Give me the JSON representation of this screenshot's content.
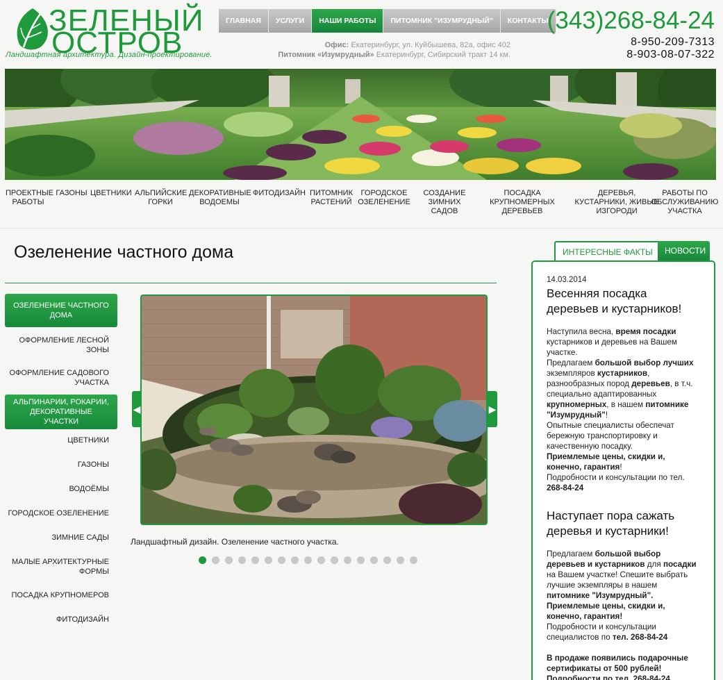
{
  "logo": {
    "word1": "ЗЕЛЕНЫЙ",
    "word2": "ОСТРОВ",
    "tagline": "Ландшафтная архитектура. Дизайн-проектирование."
  },
  "topnav": [
    {
      "label": "ГЛАВНАЯ"
    },
    {
      "label": "УСЛУГИ"
    },
    {
      "label": "НАШИ РАБОТЫ",
      "active": true
    },
    {
      "label": "ПИТОМНИК \"ИЗУМРУДНЫЙ\""
    },
    {
      "label": "КОНТАКТЫ"
    }
  ],
  "office": {
    "office_label": "Офис:",
    "office_address": "Екатеринбург, ул. Куйбышева, 82а, офис 402",
    "nursery_label": "Питомник «Изумрудный»",
    "nursery_address": "Екатеринбург, Сибирский тракт 14 км."
  },
  "phones": {
    "main": "(343)268-84-24",
    "alt1": "8-950-209-7313",
    "alt2": "8-903-08-07-322"
  },
  "catnav": [
    {
      "l1": "ПРОЕКТНЫЕ",
      "l2": "РАБОТЫ",
      "l3": ""
    },
    {
      "l1": "ГАЗОНЫ",
      "l2": "",
      "l3": ""
    },
    {
      "l1": "ЦВЕТНИКИ",
      "l2": "",
      "l3": ""
    },
    {
      "l1": "АЛЬПИЙСКИЕ",
      "l2": "ГОРКИ",
      "l3": ""
    },
    {
      "l1": "ДЕКОРАТИВНЫЕ",
      "l2": "ВОДОЕМЫ",
      "l3": ""
    },
    {
      "l1": "ФИТОДИЗАЙН",
      "l2": "",
      "l3": ""
    },
    {
      "l1": "ПИТОМНИК",
      "l2": "РАСТЕНИЙ",
      "l3": ""
    },
    {
      "l1": "ГОРОДСКОЕ",
      "l2": "ОЗЕЛЕНЕНИЕ",
      "l3": ""
    },
    {
      "l1": "СОЗДАНИЕ",
      "l2": "ЗИМНИХ",
      "l3": "САДОВ"
    },
    {
      "l1": "ПОСАДКА",
      "l2": "КРУПНОМЕРНЫХ",
      "l3": "ДЕРЕВЬЕВ"
    },
    {
      "l1": "ДЕРЕВЬЯ,",
      "l2": "КУСТАРНИКИ, ЖИВЫЕ",
      "l3": "ИЗГОРОДИ"
    },
    {
      "l1": "РАБОТЫ ПО",
      "l2": "ОБСЛУЖИВАНИЮ",
      "l3": "УЧАСТКА"
    }
  ],
  "page_title": "Озеленение частного дома",
  "sidebar": [
    {
      "l1": "ОЗЕЛЕНЕНИЕ ЧАСТНОГО",
      "l2": "ДОМА",
      "active": true
    },
    {
      "l1": "ОФОРМЛЕНИЕ ЛЕСНОЙ",
      "l2": "ЗОНЫ"
    },
    {
      "l1": "ОФОРМЛЕНИЕ САДОВОГО",
      "l2": "УЧАСТКА"
    },
    {
      "l1": "АЛЬПИНАРИИ, РОКАРИИ,",
      "l2": "ДЕКОРАТИВНЫЕ УЧАСТКИ",
      "active": true
    },
    {
      "l1": "ЦВЕТНИКИ",
      "l2": ""
    },
    {
      "l1": "ГАЗОНЫ",
      "l2": ""
    },
    {
      "l1": "ВОДОЁМЫ",
      "l2": ""
    },
    {
      "l1": "ГОРОДСКОЕ ОЗЕЛЕНЕНИЕ",
      "l2": ""
    },
    {
      "l1": "ЗИМНИЕ САДЫ",
      "l2": ""
    },
    {
      "l1": "МАЛЫЕ АРХИТЕКТУРНЫЕ",
      "l2": "ФОРМЫ"
    },
    {
      "l1": "ПОСАДКА КРУПНОМЕРОВ",
      "l2": ""
    },
    {
      "l1": "ФИТОДИЗАЙН",
      "l2": ""
    }
  ],
  "slider": {
    "caption": "Ландшафтный дизайн. Озеленение частного участка.",
    "prev_icon": "chevron-left-icon",
    "next_icon": "chevron-right-icon",
    "dot_count": 17,
    "active_dot": 0
  },
  "tabs": {
    "facts": "ИНТЕРЕСНЫЕ ФАКТЫ",
    "news": "НОВОСТИ"
  },
  "news": {
    "n1_date": "14.03.2014",
    "n1_title": "Весенняя посадка деревьев и кустарников!",
    "n1_p1_a": "Наступила весна, ",
    "n1_p1_b": "время посадки",
    "n1_p1_c": " кустарников и деревьев на Вашем участке.",
    "n1_p2_a": "Предлагаем ",
    "n1_p2_b": "большой выбор лучших",
    "n1_p2_c": " экземпляров ",
    "n1_p2_d": "кустарников",
    "n1_p2_e": ", разнообразных пород ",
    "n1_p2_f": "деревьев",
    "n1_p2_g": ", в т.ч. специально адаптированных ",
    "n1_p2_h": "крупномерных",
    "n1_p2_i": ", в нашем ",
    "n1_p2_j": "питомнике \"Изумрудный\"",
    "n1_p2_k": "!",
    "n1_p3": "Опытные специалисты обеспечат бережную транспортировку и качественную посадку.",
    "n1_p4": "Приемлемые цены, скидки и, конечно, гарантия",
    "n1_p4_end": "!",
    "n1_p5": "Подробности и консультации по тел.",
    "n1_p5_phone": "268-84-24",
    "n2_title": "Наступает пора сажать деревья и кустарники!",
    "n2_p1_a": "Предлагаем ",
    "n2_p1_b": "большой выбор деревьев и кустарников",
    "n2_p1_c": " для ",
    "n2_p1_d": "посадки",
    "n2_p1_e": " на Вашем участке! Спешите выбрать лучшие экземпляры в нашем ",
    "n2_p1_f": "питомнике \"Изумрудный\".",
    "n2_p2": "Приемлемые цены, скидки и, конечно, гарантия!",
    "n2_p3_a": "Подробности и консультации специалистов по ",
    "n2_p3_b": "тел. 268-84-24",
    "n3_p1": "В продаже появились подарочные сертификаты от 500 рублей!",
    "n3_p2": "Подробности по тел. 268-84-24"
  }
}
